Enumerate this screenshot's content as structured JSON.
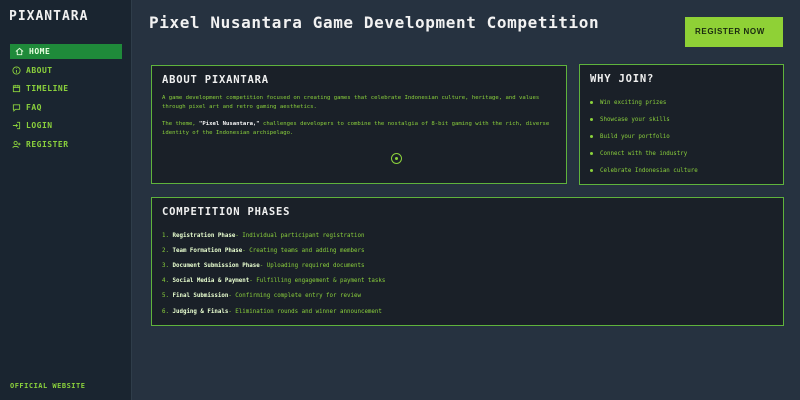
{
  "sidebar": {
    "logo": "PIXANTARA",
    "items": [
      {
        "label": "HOME",
        "icon": "home-icon"
      },
      {
        "label": "ABOUT",
        "icon": "info-icon"
      },
      {
        "label": "TIMELINE",
        "icon": "timeline-icon"
      },
      {
        "label": "FAQ",
        "icon": "help-icon"
      },
      {
        "label": "LOGIN",
        "icon": "login-icon"
      },
      {
        "label": "REGISTER",
        "icon": "user-plus-icon"
      }
    ],
    "footer": "OFFICIAL WEBSITE"
  },
  "header": {
    "title": "Pixel Nusantara Game Development Competition",
    "register_label": "REGISTER NOW"
  },
  "about": {
    "heading": "ABOUT PIXANTARA",
    "p1": "A game development competition focused on creating games that celebrate Indonesian culture, heritage, and values through pixel art and retro gaming aesthetics.",
    "p2_pre": "The theme, ",
    "p2_theme": "\"Pixel Nusantara,\"",
    "p2_post": " challenges developers to combine the nostalgia of 8-bit gaming with the rich, diverse identity of the Indonesian archipelago."
  },
  "why": {
    "heading": "WHY JOIN?",
    "items": [
      "Win exciting prizes",
      "Showcase your skills",
      "Build your portfolio",
      "Connect with the industry",
      "Celebrate Indonesian culture"
    ]
  },
  "phases": {
    "heading": "COMPETITION PHASES",
    "items": [
      {
        "num": "1.",
        "name": "Registration Phase",
        "desc": " - Individual participant registration"
      },
      {
        "num": "2.",
        "name": "Team Formation Phase",
        "desc": " - Creating teams and adding members"
      },
      {
        "num": "3.",
        "name": "Document Submission Phase",
        "desc": " - Uploading required documents"
      },
      {
        "num": "4.",
        "name": "Social Media & Payment",
        "desc": " - Fulfilling engagement & payment tasks"
      },
      {
        "num": "5.",
        "name": "Final Submission",
        "desc": " - Confirming complete entry for review"
      },
      {
        "num": "6.",
        "name": "Judging & Finals",
        "desc": " - Elimination rounds and winner announcement"
      }
    ]
  },
  "colors": {
    "accent": "#8bd13c",
    "active_nav": "#1f8a3a",
    "background": "#263240"
  }
}
